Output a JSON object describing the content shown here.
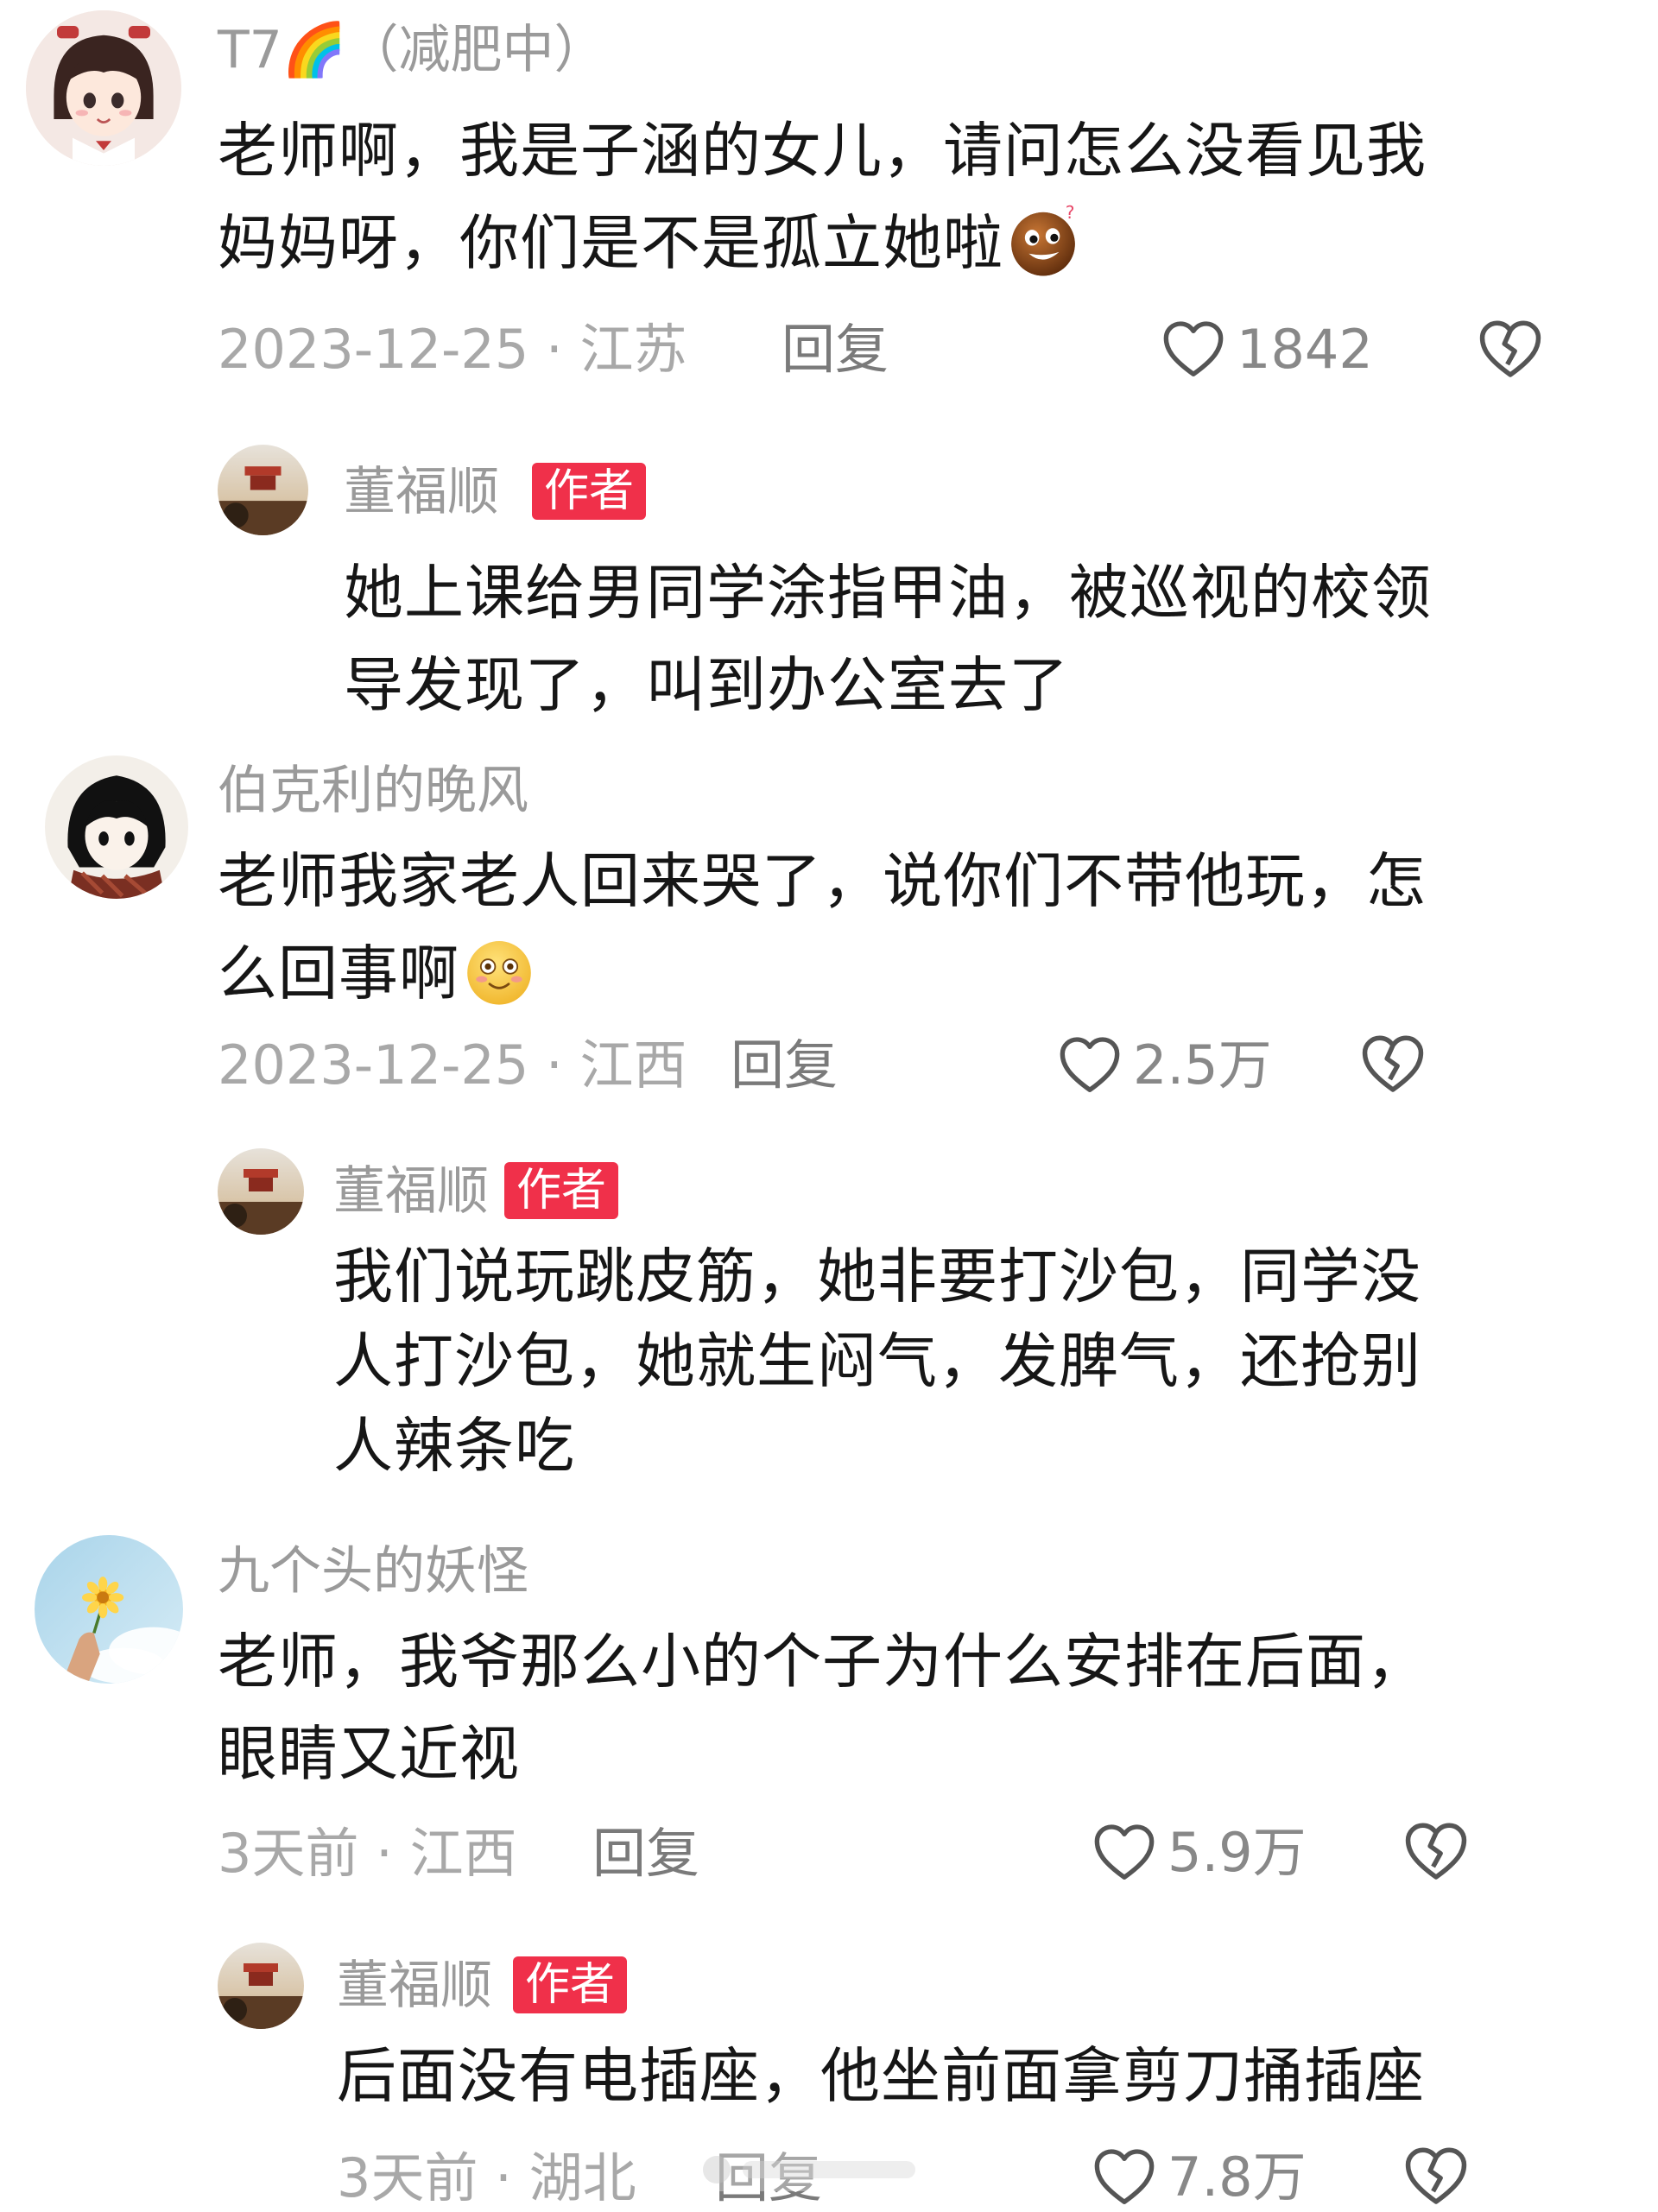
{
  "comments": [
    {
      "username": "T7🌈（减肥中）",
      "text_parts": [
        "老师啊，我是子涵的女儿，请问怎么没看见我",
        "妈妈呀，你们是不是孤立她啦"
      ],
      "date_location": "2023-12-25 · 江苏",
      "reply_label": "回复",
      "likes": "1842",
      "author_reply": {
        "username": "董福顺",
        "badge": "作者",
        "text_parts": [
          "她上课给男同学涂指甲油，被巡视的校领",
          "导发现了，叫到办公室去了"
        ]
      }
    },
    {
      "username": "伯克利的晚风",
      "text_parts": [
        "老师我家老人回来哭了，说你们不带他玩，怎",
        "么回事啊"
      ],
      "date_location": "2023-12-25 · 江西",
      "reply_label": "回复",
      "likes": "2.5万",
      "author_reply": {
        "username": "董福顺",
        "badge": "作者",
        "text_parts": [
          "我们说玩跳皮筋，她非要打沙包，同学没",
          "人打沙包，她就生闷气，发脾气，还抢别",
          "人辣条吃"
        ]
      }
    },
    {
      "username": "九个头的妖怪",
      "text_parts": [
        "老师，我爷那么小的个子为什么安排在后面，",
        "眼睛又近视"
      ],
      "date_location": "3天前 · 江西",
      "reply_label": "回复",
      "likes": "5.9万",
      "author_reply": {
        "username": "董福顺",
        "badge": "作者",
        "text_parts": [
          "后面没有电插座，他坐前面拿剪刀捅插座"
        ],
        "date_location": "3天前 · 湖北",
        "reply_label": "回复",
        "likes": "7.8万"
      }
    }
  ],
  "icons": {
    "like": "heart-outline-icon",
    "dislike": "broken-heart-icon",
    "emoji1": "shy-peek-emoji",
    "emoji2": "blushing-smile-emoji"
  },
  "colors": {
    "badge_bg": "#f0304a",
    "username": "#9a9a9a",
    "meta": "#a8a8a8"
  }
}
